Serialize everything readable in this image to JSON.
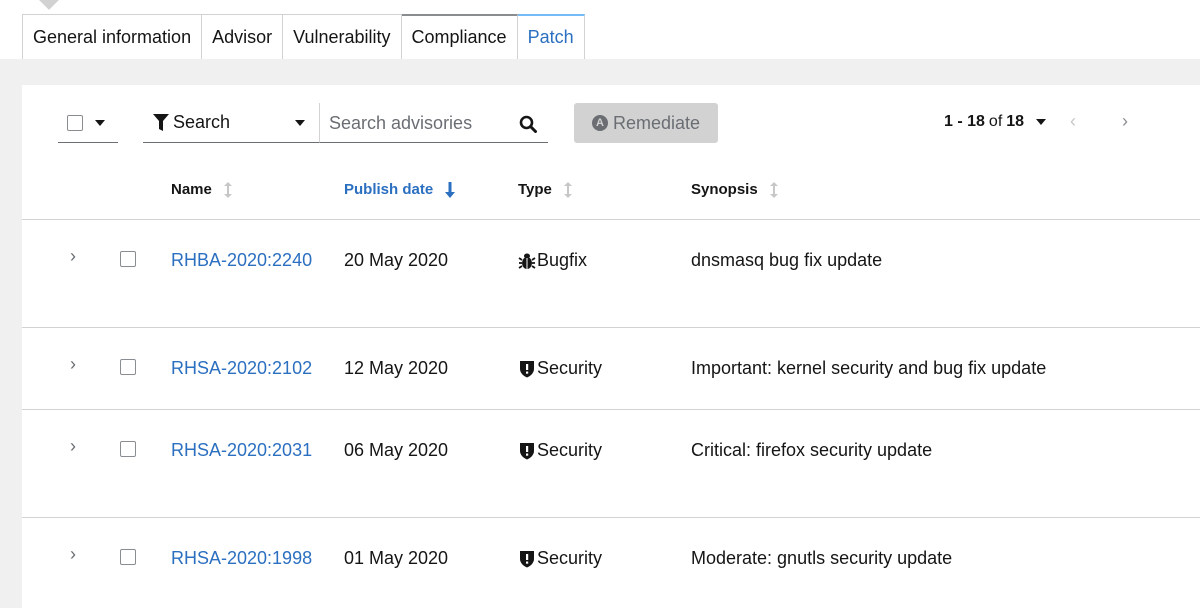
{
  "tabs": [
    {
      "label": "General information",
      "active": false
    },
    {
      "label": "Advisor",
      "active": false
    },
    {
      "label": "Vulnerability",
      "active": false
    },
    {
      "label": "Compliance",
      "active": false
    },
    {
      "label": "Patch",
      "active": true
    }
  ],
  "toolbar": {
    "filter_label": "Search",
    "search_placeholder": "Search advisories",
    "remediate_label": "Remediate",
    "remediate_icon_letter": "A"
  },
  "pagination": {
    "range": "1 - 18",
    "of_label": "of",
    "total": "18"
  },
  "table": {
    "columns": {
      "name": "Name",
      "publish_date": "Publish date",
      "type": "Type",
      "synopsis": "Synopsis"
    },
    "sorted_column": "publish_date",
    "sort_direction": "descending",
    "rows": [
      {
        "name": "RHBA-2020:2240",
        "date": "20 May 2020",
        "type": "Bugfix",
        "type_icon": "bug-icon",
        "synopsis": "dnsmasq bug fix update"
      },
      {
        "name": "RHSA-2020:2102",
        "date": "12 May 2020",
        "type": "Security",
        "type_icon": "shield-icon",
        "synopsis": "Important: kernel security and bug fix update"
      },
      {
        "name": "RHSA-2020:2031",
        "date": "06 May 2020",
        "type": "Security",
        "type_icon": "shield-icon",
        "synopsis": "Critical: firefox security update"
      },
      {
        "name": "RHSA-2020:1998",
        "date": "01 May 2020",
        "type": "Security",
        "type_icon": "shield-icon",
        "synopsis": "Moderate: gnutls security update"
      }
    ]
  },
  "colors": {
    "link": "#2b6fc0",
    "active_tab_border": "#73bcf7",
    "page_background": "#f0f0f0",
    "button_disabled": "#d2d2d2"
  }
}
